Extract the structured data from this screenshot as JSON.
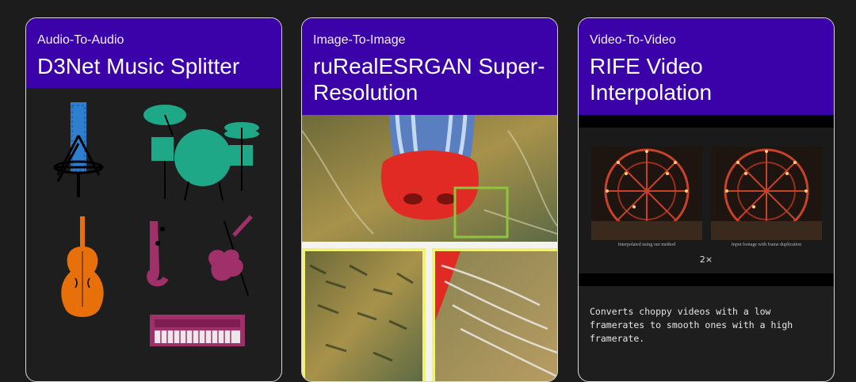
{
  "cards": [
    {
      "category": "Audio-To-Audio",
      "title": "D3Net Music Splitter",
      "icons": [
        "microphone-icon",
        "drum-kit-icon",
        "double-bass-icon",
        "saxophone-icon",
        "violin-icon",
        "keyboard-icon"
      ]
    },
    {
      "category": "Image-To-Image",
      "title": "ruRealESRGAN Super-Resolution"
    },
    {
      "category": "Video-To-Video",
      "title": "RIFE Video Interpolation",
      "caption_left": "Interpolated using our method",
      "caption_right": "Input footage with frame duplication",
      "multiplier": "2×",
      "description": "Converts choppy videos with a low framerates to smooth ones with a high framerate."
    }
  ],
  "colors": {
    "header": "#3a02a8",
    "background": "#1c1c1c",
    "mic": "#2f7fd0",
    "drums": "#1fa888",
    "bass": "#e8700a",
    "winds": "#a0306a",
    "crop_box": "#8fc43c"
  }
}
